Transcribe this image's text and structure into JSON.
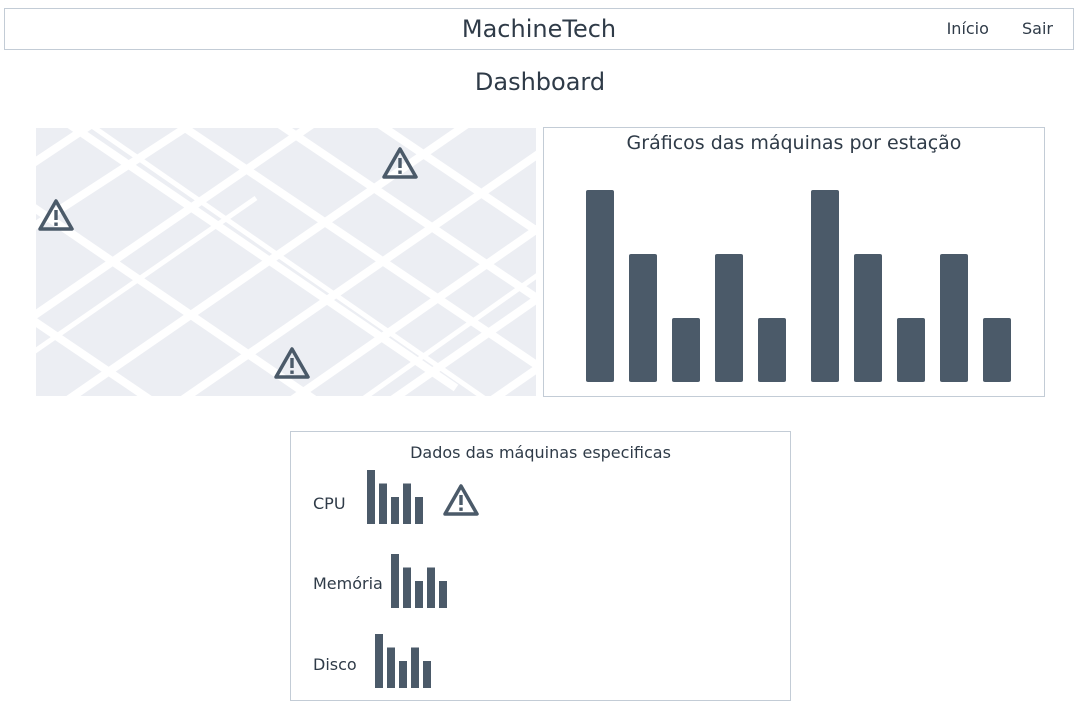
{
  "header": {
    "brand": "MachineTech",
    "nav": [
      {
        "label": "Início"
      },
      {
        "label": "Sair"
      }
    ]
  },
  "page_title": "Dashboard",
  "map": {
    "alert_icon": "warning-triangle-icon",
    "alert_count": 3
  },
  "station_chart": {
    "title": "Gráficos das máquinas por estação",
    "chart_data": {
      "type": "bar",
      "groups": 2,
      "values": [
        3,
        2,
        1,
        2,
        1,
        3,
        2,
        1,
        2,
        1
      ],
      "ylim": [
        0,
        3
      ],
      "xlabel": "",
      "ylabel": "",
      "grid": false,
      "legend": "none",
      "bar_color": "#4b5a69"
    }
  },
  "machine_panel": {
    "title": "Dados das máquinas especificas",
    "metrics": [
      {
        "label": "Memória",
        "values": [
          4,
          3,
          2,
          3,
          2
        ],
        "alert": false
      },
      {
        "label": "Disco",
        "values": [
          4,
          3,
          2,
          3,
          2
        ],
        "alert": false
      }
    ],
    "cpu": {
      "label": "CPU",
      "values": [
        4,
        3,
        2,
        3,
        2
      ],
      "alert": true
    }
  },
  "colors": {
    "accent": "#4b5a69",
    "border": "#c3ccd6",
    "map_bg": "#eceef3",
    "text": "#2f3b48"
  }
}
